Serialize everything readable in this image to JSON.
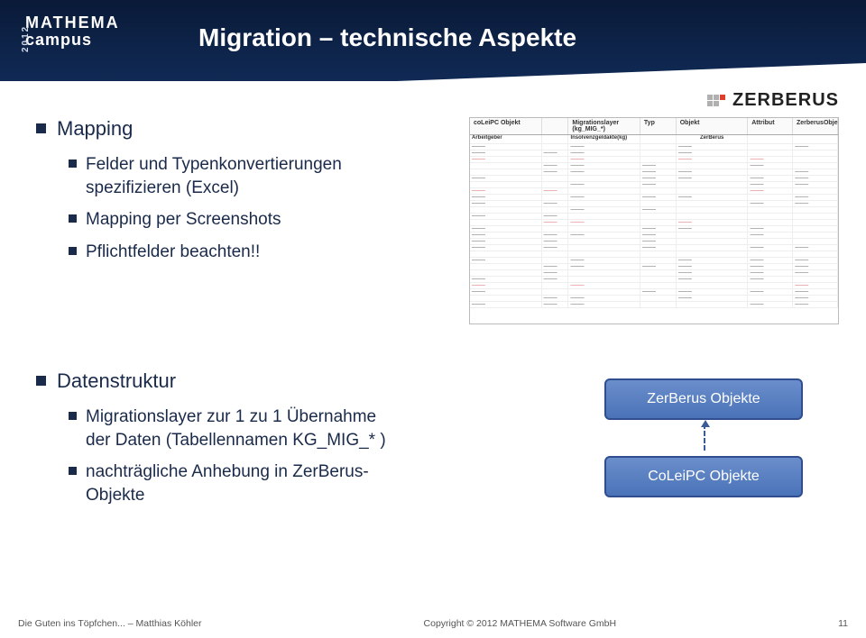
{
  "logo": {
    "line1": "MATHEMA",
    "line2": "campus",
    "year": "2012"
  },
  "slide_title": "Migration – technische Aspekte",
  "brand": "ZERBERUS",
  "bullets": {
    "mapping": {
      "title": "Mapping",
      "items": [
        "Felder und Typenkonvertierungen spezifizieren (Excel)",
        "Mapping per Screenshots",
        "Pflichtfelder beachten!!"
      ]
    },
    "datastructure": {
      "title": "Datenstruktur",
      "items": [
        "Migrationslayer zur 1 zu 1 Übernahme der Daten (Tabellennamen KG_MIG_* )",
        "nachträgliche Anhebung in ZerBerus-Objekte"
      ]
    }
  },
  "diagram": {
    "box1": "ZerBerus Objekte",
    "box2": "CoLeiPC Objekte"
  },
  "excel": {
    "headers": [
      "coLeiPC Objekt",
      "",
      "Migrationslayer (kg_MIG_*)",
      "Typ",
      "Objekt",
      "Attribut",
      "ZerberusObjekte"
    ],
    "top_left": "Arbeitgeber",
    "top_mid": "Insolvenzgeldakte(kg)",
    "top_right": "ZerBerus"
  },
  "footer": {
    "left": "Die Guten ins Töpfchen... – Matthias Köhler",
    "center": "Copyright © 2012 MATHEMA Software GmbH",
    "right": "11"
  }
}
